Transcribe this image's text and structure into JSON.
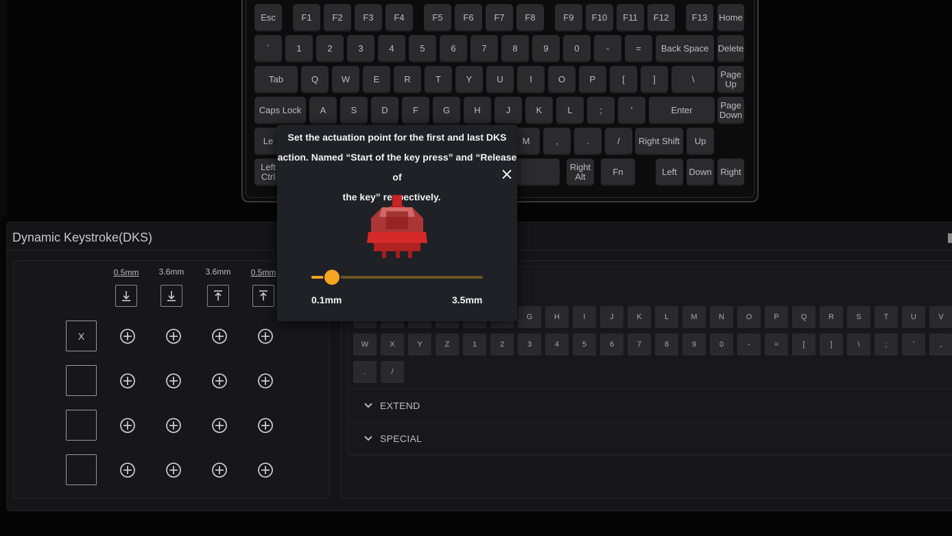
{
  "keyboard": {
    "rows": [
      [
        "Esc",
        "F1",
        "F2",
        "F3",
        "F4",
        "F5",
        "F6",
        "F7",
        "F8",
        "F9",
        "F10",
        "F11",
        "F12",
        "F13",
        "Home"
      ],
      [
        "`",
        "1",
        "2",
        "3",
        "4",
        "5",
        "6",
        "7",
        "8",
        "9",
        "0",
        "-",
        "=",
        "Back Space",
        "Delete"
      ],
      [
        "Tab",
        "Q",
        "W",
        "E",
        "R",
        "T",
        "Y",
        "U",
        "I",
        "O",
        "P",
        "[",
        "]",
        "\\",
        "Page Up"
      ],
      [
        "Caps Lock",
        "A",
        "S",
        "D",
        "F",
        "G",
        "H",
        "J",
        "K",
        "L",
        ";",
        "'",
        "Enter",
        "Page Down"
      ],
      [
        "Le",
        "M",
        ",",
        ".",
        "/",
        "Right Shift",
        "Up"
      ],
      [
        "Left Ctrl",
        "Right Alt",
        "Fn",
        "Left",
        "Down",
        "Right"
      ]
    ]
  },
  "dks": {
    "title": "Dynamic Keystroke(DKS)",
    "columns": [
      {
        "value": "0.5mm",
        "direction": "press",
        "underlined": true
      },
      {
        "value": "3.6mm",
        "direction": "press",
        "underlined": false
      },
      {
        "value": "3.6mm",
        "direction": "release",
        "underlined": false
      },
      {
        "value": "0.5mm",
        "direction": "release",
        "underlined": true
      }
    ],
    "slots": [
      "X",
      "",
      "",
      ""
    ]
  },
  "key_grid": {
    "row1": [
      "G",
      "H",
      "I",
      "J",
      "K",
      "L",
      "M",
      "N",
      "O",
      "P",
      "Q",
      "R",
      "S",
      "T",
      "U",
      "V"
    ],
    "row2": [
      "W",
      "X",
      "Y",
      "Z",
      "1",
      "2",
      "3",
      "4",
      "5",
      "6",
      "7",
      "8",
      "9",
      "0",
      "-",
      "=",
      "[",
      "]",
      "\\",
      ";",
      "'",
      ","
    ],
    "row3": [
      ".",
      "/"
    ]
  },
  "sections": {
    "extend": "EXTEND",
    "special": "SPECIAL"
  },
  "popover": {
    "line1": "Set the actuation point for the first and last DKS",
    "line2": "action. Named “Start of the key press” and “Release of",
    "line3": "the key” respectively.",
    "slider_min": "0.1mm",
    "slider_max": "3.5mm",
    "slider_fraction": 0.12
  },
  "colors": {
    "accent": "#f5a623",
    "switch_red": "#d42a2a"
  }
}
